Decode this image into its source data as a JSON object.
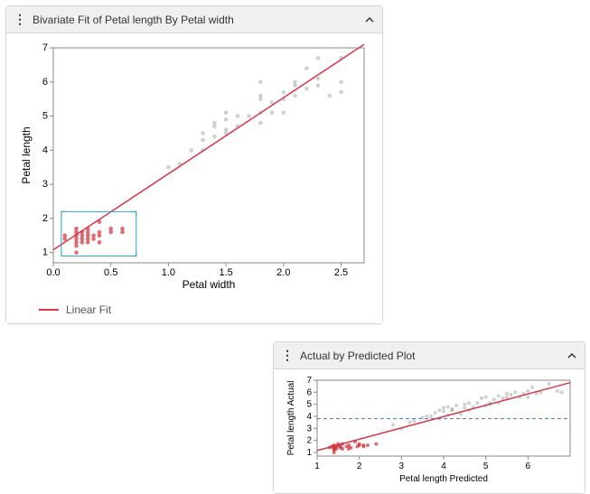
{
  "panel1": {
    "title": "Bivariate Fit of Petal length By Petal width",
    "ylabel": "Petal length",
    "xlabel": "Petal width",
    "legend": "Linear Fit"
  },
  "panel2": {
    "title": "Actual by Predicted Plot",
    "ylabel": "Petal length Actual",
    "xlabel": "Petal length Predicted"
  },
  "chart_data": [
    {
      "type": "scatter",
      "title": "Bivariate Fit of Petal length By Petal width",
      "xlabel": "Petal width",
      "ylabel": "Petal length",
      "xlim": [
        0.0,
        2.7
      ],
      "ylim": [
        0.7,
        7
      ],
      "xticks": [
        0.0,
        0.5,
        1.0,
        1.5,
        2.0,
        2.5
      ],
      "yticks": [
        1,
        2,
        3,
        4,
        5,
        6,
        7
      ],
      "fit_line": {
        "slope": 2.23,
        "intercept": 1.08
      },
      "selection_box": {
        "xmin": 0.07,
        "xmax": 0.72,
        "ymin": 0.9,
        "ymax": 2.2
      },
      "series": [
        {
          "name": "unselected",
          "color": "grey",
          "points": [
            [
              1.0,
              3.5
            ],
            [
              1.1,
              3.6
            ],
            [
              1.2,
              4.0
            ],
            [
              1.3,
              4.0
            ],
            [
              1.3,
              4.3
            ],
            [
              1.3,
              4.5
            ],
            [
              1.4,
              4.4
            ],
            [
              1.4,
              4.7
            ],
            [
              1.4,
              4.8
            ],
            [
              1.5,
              4.5
            ],
            [
              1.5,
              4.6
            ],
            [
              1.5,
              4.9
            ],
            [
              1.5,
              5.1
            ],
            [
              1.6,
              4.7
            ],
            [
              1.6,
              5.0
            ],
            [
              1.7,
              5.0
            ],
            [
              1.8,
              4.8
            ],
            [
              1.8,
              5.1
            ],
            [
              1.8,
              5.5
            ],
            [
              1.8,
              5.6
            ],
            [
              1.8,
              6.0
            ],
            [
              1.9,
              5.1
            ],
            [
              1.9,
              5.4
            ],
            [
              2.0,
              5.1
            ],
            [
              2.0,
              5.5
            ],
            [
              2.0,
              5.7
            ],
            [
              2.1,
              5.6
            ],
            [
              2.1,
              5.9
            ],
            [
              2.1,
              6.0
            ],
            [
              2.2,
              5.8
            ],
            [
              2.2,
              6.4
            ],
            [
              2.3,
              5.9
            ],
            [
              2.3,
              6.1
            ],
            [
              2.3,
              6.7
            ],
            [
              2.4,
              5.6
            ],
            [
              2.5,
              5.7
            ],
            [
              2.5,
              6.0
            ],
            [
              2.5,
              6.7
            ]
          ]
        },
        {
          "name": "selected",
          "color": "red",
          "points": [
            [
              0.1,
              1.4
            ],
            [
              0.1,
              1.5
            ],
            [
              0.2,
              1.0
            ],
            [
              0.2,
              1.2
            ],
            [
              0.2,
              1.3
            ],
            [
              0.2,
              1.4
            ],
            [
              0.2,
              1.5
            ],
            [
              0.2,
              1.6
            ],
            [
              0.2,
              1.7
            ],
            [
              0.25,
              1.3
            ],
            [
              0.25,
              1.4
            ],
            [
              0.25,
              1.5
            ],
            [
              0.25,
              1.6
            ],
            [
              0.3,
              1.3
            ],
            [
              0.3,
              1.4
            ],
            [
              0.3,
              1.5
            ],
            [
              0.3,
              1.6
            ],
            [
              0.3,
              1.7
            ],
            [
              0.35,
              1.4
            ],
            [
              0.35,
              1.5
            ],
            [
              0.4,
              1.3
            ],
            [
              0.4,
              1.5
            ],
            [
              0.4,
              1.6
            ],
            [
              0.4,
              1.9
            ],
            [
              0.5,
              1.6
            ],
            [
              0.5,
              1.7
            ],
            [
              0.6,
              1.6
            ],
            [
              0.6,
              1.7
            ]
          ]
        }
      ],
      "legend": [
        "Linear Fit"
      ]
    },
    {
      "type": "scatter",
      "title": "Actual by Predicted Plot",
      "xlabel": "Petal length Predicted",
      "ylabel": "Petal length Actual",
      "xlim": [
        1,
        7
      ],
      "ylim": [
        0.7,
        7
      ],
      "xticks": [
        1,
        2,
        3,
        4,
        5,
        6
      ],
      "yticks": [
        1,
        2,
        3,
        4,
        5,
        6,
        7
      ],
      "reference_hline_y": 3.8,
      "fit_line": {
        "slope": 0.94,
        "intercept": 0.22
      },
      "series": [
        {
          "name": "unselected",
          "color": "grey",
          "points": [
            [
              2.8,
              3.3
            ],
            [
              3.0,
              3.0
            ],
            [
              3.2,
              3.5
            ],
            [
              3.3,
              3.6
            ],
            [
              3.5,
              3.9
            ],
            [
              3.6,
              4.0
            ],
            [
              3.7,
              4.0
            ],
            [
              3.8,
              4.3
            ],
            [
              3.9,
              4.5
            ],
            [
              3.9,
              3.8
            ],
            [
              4.0,
              4.4
            ],
            [
              4.0,
              4.7
            ],
            [
              4.1,
              4.1
            ],
            [
              4.1,
              4.8
            ],
            [
              4.2,
              4.5
            ],
            [
              4.2,
              4.6
            ],
            [
              4.3,
              4.9
            ],
            [
              4.4,
              4.2
            ],
            [
              4.5,
              4.7
            ],
            [
              4.5,
              5.0
            ],
            [
              4.6,
              4.5
            ],
            [
              4.6,
              5.1
            ],
            [
              4.7,
              4.8
            ],
            [
              4.8,
              5.1
            ],
            [
              4.9,
              5.5
            ],
            [
              5.0,
              4.9
            ],
            [
              5.0,
              5.6
            ],
            [
              5.1,
              5.0
            ],
            [
              5.1,
              5.1
            ],
            [
              5.2,
              5.4
            ],
            [
              5.3,
              5.1
            ],
            [
              5.3,
              5.7
            ],
            [
              5.4,
              5.5
            ],
            [
              5.5,
              5.6
            ],
            [
              5.5,
              5.9
            ],
            [
              5.6,
              5.8
            ],
            [
              5.7,
              6.0
            ],
            [
              5.8,
              5.6
            ],
            [
              5.9,
              5.9
            ],
            [
              6.0,
              6.1
            ],
            [
              6.0,
              5.6
            ],
            [
              6.1,
              6.4
            ],
            [
              6.2,
              5.9
            ],
            [
              6.3,
              6.0
            ],
            [
              6.5,
              6.7
            ],
            [
              6.7,
              6.1
            ],
            [
              6.8,
              6.0
            ]
          ]
        },
        {
          "name": "selected",
          "color": "red",
          "points": [
            [
              1.3,
              1.4
            ],
            [
              1.35,
              1.5
            ],
            [
              1.4,
              1.0
            ],
            [
              1.4,
              1.2
            ],
            [
              1.4,
              1.3
            ],
            [
              1.4,
              1.4
            ],
            [
              1.4,
              1.5
            ],
            [
              1.4,
              1.6
            ],
            [
              1.45,
              1.3
            ],
            [
              1.45,
              1.4
            ],
            [
              1.45,
              1.5
            ],
            [
              1.5,
              1.7
            ],
            [
              1.5,
              1.6
            ],
            [
              1.55,
              1.4
            ],
            [
              1.55,
              1.5
            ],
            [
              1.6,
              1.3
            ],
            [
              1.6,
              1.7
            ],
            [
              1.7,
              1.5
            ],
            [
              1.75,
              1.3
            ],
            [
              1.75,
              1.6
            ],
            [
              1.8,
              1.4
            ],
            [
              1.9,
              1.9
            ],
            [
              1.95,
              1.5
            ],
            [
              2.0,
              1.6
            ],
            [
              2.0,
              1.7
            ],
            [
              2.1,
              1.5
            ],
            [
              2.1,
              1.6
            ],
            [
              2.2,
              1.6
            ],
            [
              2.4,
              1.7
            ]
          ]
        }
      ]
    }
  ]
}
